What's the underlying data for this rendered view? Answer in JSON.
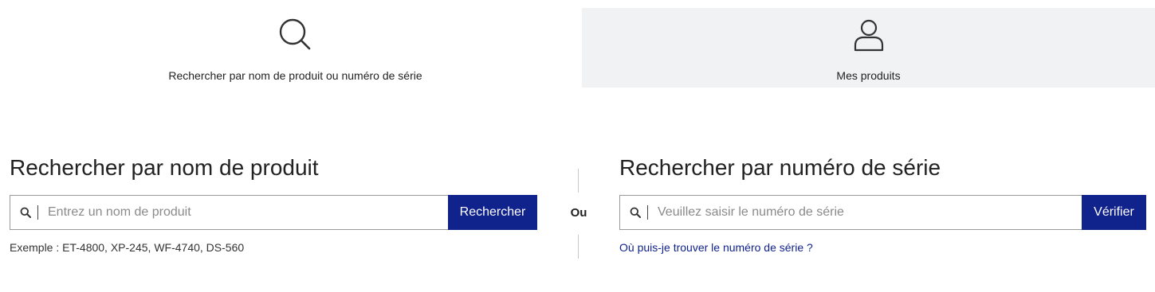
{
  "tabs": {
    "search": {
      "label": "Rechercher par nom de produit ou numéro de série",
      "icon": "search-icon"
    },
    "my_products": {
      "label": "Mes produits",
      "icon": "user-icon"
    }
  },
  "product_search": {
    "title": "Rechercher par nom de produit",
    "placeholder": "Entrez un nom de produit",
    "button": "Rechercher",
    "example": "Exemple : ET-4800, XP-245, WF-4740, DS-560"
  },
  "or_label": "Ou",
  "serial_search": {
    "title": "Rechercher par numéro de série",
    "placeholder": "Veuillez saisir le numéro de série",
    "button": "Vérifier",
    "help_link": "Où puis-je trouver le numéro de série ?"
  },
  "colors": {
    "primary": "#10228c",
    "tab_inactive_bg": "#f1f2f4"
  }
}
